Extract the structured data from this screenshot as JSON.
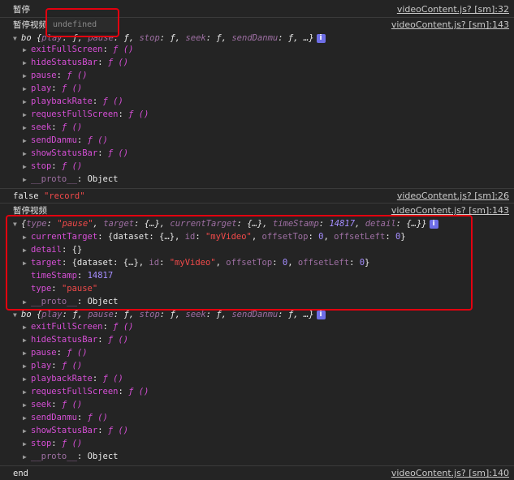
{
  "log1": {
    "text": "暂停",
    "src": "videoContent.js? [sm]:32"
  },
  "tooltip": "undefined",
  "log2": {
    "text": "暂停视频",
    "src": "videoContent.js? [sm]:143"
  },
  "bo_summary": {
    "prefix": "bo {",
    "items": [
      {
        "k": "play",
        "v": "ƒ"
      },
      {
        "k": "pause",
        "v": "ƒ"
      },
      {
        "k": "stop",
        "v": "ƒ"
      },
      {
        "k": "seek",
        "v": "ƒ"
      },
      {
        "k": "sendDanmu",
        "v": "ƒ"
      }
    ],
    "suffix": "…}",
    "info": "i"
  },
  "bo_props": [
    {
      "key": "exitFullScreen",
      "value": "ƒ ()"
    },
    {
      "key": "hideStatusBar",
      "value": "ƒ ()"
    },
    {
      "key": "pause",
      "value": "ƒ ()"
    },
    {
      "key": "play",
      "value": "ƒ ()"
    },
    {
      "key": "playbackRate",
      "value": "ƒ ()"
    },
    {
      "key": "requestFullScreen",
      "value": "ƒ ()"
    },
    {
      "key": "seek",
      "value": "ƒ ()"
    },
    {
      "key": "sendDanmu",
      "value": "ƒ ()"
    },
    {
      "key": "showStatusBar",
      "value": "ƒ ()"
    },
    {
      "key": "stop",
      "value": "ƒ ()"
    }
  ],
  "proto": {
    "key": "__proto__",
    "value": "Object"
  },
  "log3": {
    "bool": "false",
    "str": "\"record\"",
    "src": "videoContent.js? [sm]:26"
  },
  "log4": {
    "text": "暂停视频",
    "src": "videoContent.js? [sm]:143"
  },
  "event_summary": {
    "open": "{",
    "type_key": "type",
    "type_val": "\"pause\"",
    "target_key": "target",
    "target_val": "{…}",
    "ct_key": "currentTarget",
    "ct_val": "{…}",
    "ts_key": "timeStamp",
    "ts_val": "14817",
    "detail_key": "detail",
    "detail_val": "{…}",
    "close": "}"
  },
  "current_target": {
    "key": "currentTarget",
    "dataset": "dataset: {…}",
    "id_key": "id",
    "id_val": "\"myVideo\"",
    "ot_key": "offsetTop",
    "ot_val": "0",
    "ol_key": "offsetLeft",
    "ol_val": "0"
  },
  "detail": {
    "key": "detail",
    "value": "{}"
  },
  "target": {
    "key": "target",
    "dataset": "dataset: {…}",
    "id_key": "id",
    "id_val": "\"myVideo\"",
    "ot_key": "offsetTop",
    "ot_val": "0",
    "ol_key": "offsetLeft",
    "ol_val": "0"
  },
  "time_stamp": {
    "key": "timeStamp",
    "value": "14817"
  },
  "type_prop": {
    "key": "type",
    "value": "\"pause\""
  },
  "last_row": {
    "text": "end",
    "src": "videoContent.js? [sm]:140"
  }
}
